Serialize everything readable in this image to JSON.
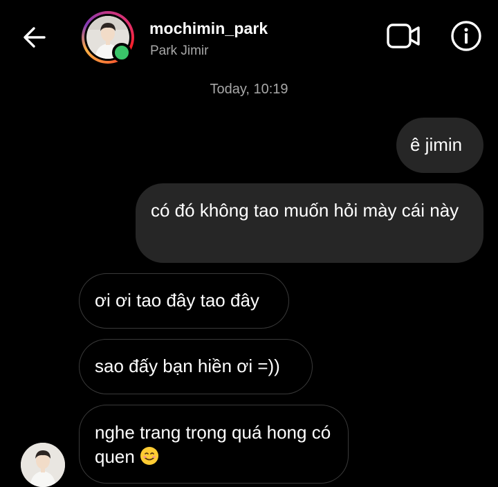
{
  "header": {
    "username": "mochimin_park",
    "subname": "Park Jimir"
  },
  "conversation": {
    "timestamp": "Today, 10:19",
    "messages": [
      {
        "direction": "sent",
        "text": "ê jimin"
      },
      {
        "direction": "sent",
        "text": "có đó không tao muốn hỏi mày cái này"
      },
      {
        "direction": "received",
        "text": "ơi ơi tao đây tao đây"
      },
      {
        "direction": "received",
        "text": "sao đấy bạn hiền ơi =))"
      },
      {
        "direction": "received",
        "text": "nghe trang trọng quá hong có quen",
        "emoji": "smiling-face-icon"
      }
    ]
  },
  "icons": {
    "back": "arrow-left-icon",
    "video": "video-camera-icon",
    "info": "info-circle-icon"
  },
  "colors": {
    "background": "#000000",
    "sent_bubble": "#262626",
    "received_border": "#3a3a3a",
    "online": "#3ac569",
    "secondary_text": "#a8a8a8"
  }
}
